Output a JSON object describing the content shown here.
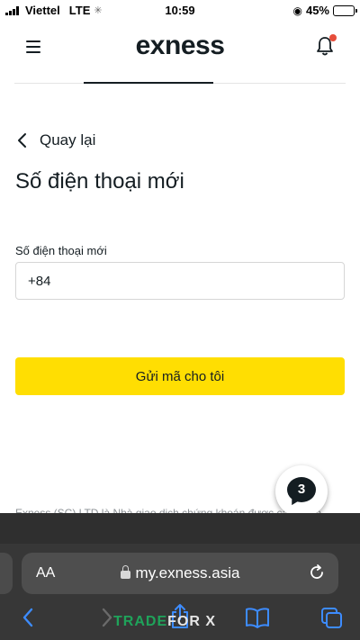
{
  "status_bar": {
    "carrier": "Viettel",
    "network": "LTE",
    "time": "10:59",
    "battery": "45%",
    "battery_level": 0.45
  },
  "header": {
    "logo": "exness",
    "menu_icon": "hamburger-icon",
    "notification_icon": "bell-icon",
    "notification_dot_color": "#e64d3b"
  },
  "content": {
    "back_label": "Quay lại",
    "title": "Số điện thoại mới",
    "phone_label": "Số điện thoại mới",
    "phone_value": "+84",
    "submit_label": "Gửi mã cho tôi",
    "submit_color": "#ffde02",
    "chat_badge": "3",
    "footer_text": "Exness (SC) LTD là Nhà giao dịch chứng khoán được cấp phép"
  },
  "browser": {
    "aa_label": "AA",
    "url": "my.exness.asia",
    "watermark_left": "TRADE",
    "watermark_right": "FOR X"
  }
}
